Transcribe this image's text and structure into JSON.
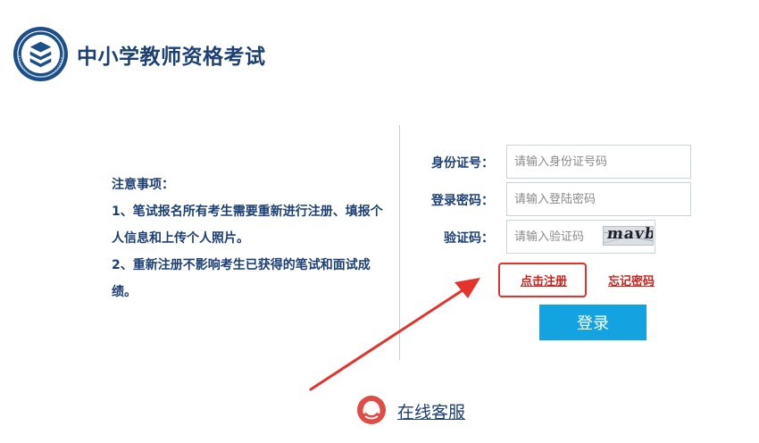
{
  "header": {
    "site_title": "中小学教师资格考试",
    "logo_icon": "certification-seal-logo"
  },
  "notice": {
    "title": "注意事项：",
    "items": [
      "1、笔试报名所有考生需要重新进行注册、填报个人信息和上传个人照片。",
      "2、重新注册不影响考生已获得的笔试和面试成绩。"
    ]
  },
  "form": {
    "id_label": "身份证号：",
    "id_placeholder": "请输入身份证号码",
    "password_label": "登录密码：",
    "password_placeholder": "请输入登陆密码",
    "captcha_label": "验证码：",
    "captcha_placeholder": "请输入验证码",
    "captcha_text": "mavb"
  },
  "links": {
    "register": "点击注册",
    "forgot_password": "忘记密码"
  },
  "login_button": "登录",
  "support": {
    "label": "在线客服",
    "icon": "customer-service-icon"
  },
  "colors": {
    "primary_text": "#1c3f74",
    "accent_red": "#e5322b",
    "button_blue": "#12a3e0"
  }
}
